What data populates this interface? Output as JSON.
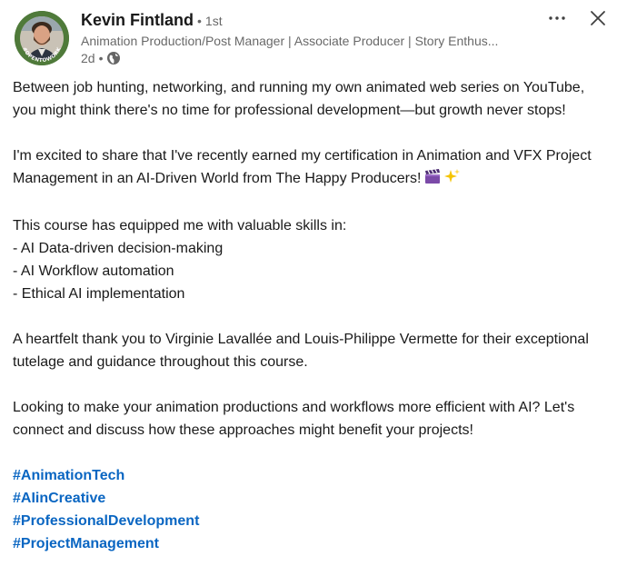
{
  "author": {
    "name": "Kevin Fintland",
    "degree": "1st",
    "headline": "Animation Production/Post Manager | Associate Producer | Story Enthus...",
    "time": "2d",
    "avatar_badge_text": "#OPENTOWORK",
    "visibility_icon": "globe-icon"
  },
  "controls": {
    "more_icon": "ellipsis-icon",
    "close_icon": "close-icon"
  },
  "post": {
    "paragraphs": [
      "Between job hunting, networking, and running my own animated web series on YouTube, you might think there's no time for professional development—but growth never stops!",
      "I'm excited to share that I've recently earned my certification in Animation and VFX Project Management in an AI-Driven World from The Happy Producers!",
      "This course has equipped me with valuable skills in:",
      "- AI Data-driven decision-making",
      "- AI Workflow automation",
      "- Ethical AI implementation",
      "A heartfelt thank you to Virginie Lavallée and Louis-Philippe Vermette for their exceptional tutelage and guidance throughout this course.",
      "Looking to make your animation productions and workflows more efficient with AI? Let's connect and discuss how these approaches might benefit your projects!"
    ],
    "emojis": [
      "clapper-board-icon",
      "sparkles-icon"
    ],
    "hashtags": [
      "#AnimationTech",
      "#AIinCreative",
      "#ProfessionalDevelopment",
      "#ProjectManagement"
    ]
  },
  "colors": {
    "link": "#0a66c2",
    "text": "#000000e6",
    "secondary": "#00000099",
    "badge_green": "#4f7a3a"
  }
}
